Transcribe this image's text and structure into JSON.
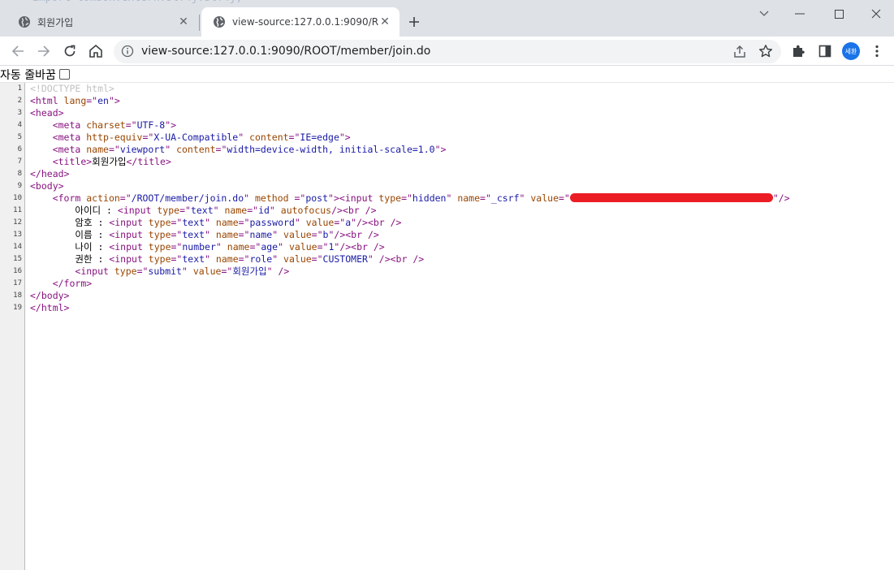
{
  "browser": {
    "tabs": [
      {
        "title": "회원가입",
        "active": false
      },
      {
        "title": "view-source:127.0.0.1:9090/ROOT/member/join.do",
        "active": true
      }
    ],
    "address": "view-source:127.0.0.1:9090/ROOT/member/join.do",
    "profile_initials": "세환",
    "icons": [
      "globe-icon",
      "close-icon",
      "plus-icon",
      "chevron-down-icon",
      "minimize-icon",
      "maximize-icon",
      "window-close-icon",
      "back-icon",
      "forward-icon",
      "reload-icon",
      "home-icon",
      "info-icon",
      "share-icon",
      "star-icon",
      "puzzle-icon",
      "side-panel-icon",
      "kebab-icon"
    ],
    "colors": {
      "tabstrip": "#dee1e6",
      "omnibox": "#f1f3f4",
      "avatar": "#1a73e8",
      "redaction": "#ec1c24"
    }
  },
  "viewsource": {
    "wrap_label": "자동 줄바꿈",
    "wrap_checked": false,
    "lines": [
      {
        "n": "1",
        "tokens": [
          {
            "c": "d",
            "t": "<!DOCTYPE html>"
          }
        ]
      },
      {
        "n": "2",
        "tokens": [
          {
            "c": "t",
            "t": "<html "
          },
          {
            "c": "a",
            "t": "lang"
          },
          {
            "c": "t",
            "t": "=\""
          },
          {
            "c": "v",
            "t": "en"
          },
          {
            "c": "t",
            "t": "\">"
          }
        ]
      },
      {
        "n": "3",
        "tokens": [
          {
            "c": "t",
            "t": "<head>"
          }
        ]
      },
      {
        "n": "4",
        "tokens": [
          {
            "c": "",
            "t": "    "
          },
          {
            "c": "t",
            "t": "<meta "
          },
          {
            "c": "a",
            "t": "charset"
          },
          {
            "c": "t",
            "t": "=\""
          },
          {
            "c": "v",
            "t": "UTF-8"
          },
          {
            "c": "t",
            "t": "\">"
          }
        ]
      },
      {
        "n": "5",
        "tokens": [
          {
            "c": "",
            "t": "    "
          },
          {
            "c": "t",
            "t": "<meta "
          },
          {
            "c": "a",
            "t": "http-equiv"
          },
          {
            "c": "t",
            "t": "=\""
          },
          {
            "c": "v",
            "t": "X-UA-Compatible"
          },
          {
            "c": "t",
            "t": "\" "
          },
          {
            "c": "a",
            "t": "content"
          },
          {
            "c": "t",
            "t": "=\""
          },
          {
            "c": "v",
            "t": "IE=edge"
          },
          {
            "c": "t",
            "t": "\">"
          }
        ]
      },
      {
        "n": "6",
        "tokens": [
          {
            "c": "",
            "t": "    "
          },
          {
            "c": "t",
            "t": "<meta "
          },
          {
            "c": "a",
            "t": "name"
          },
          {
            "c": "t",
            "t": "=\""
          },
          {
            "c": "v",
            "t": "viewport"
          },
          {
            "c": "t",
            "t": "\" "
          },
          {
            "c": "a",
            "t": "content"
          },
          {
            "c": "t",
            "t": "=\""
          },
          {
            "c": "v",
            "t": "width=device-width, initial-scale=1.0"
          },
          {
            "c": "t",
            "t": "\">"
          }
        ]
      },
      {
        "n": "7",
        "tokens": [
          {
            "c": "",
            "t": "    "
          },
          {
            "c": "t",
            "t": "<title>"
          },
          {
            "c": "",
            "t": "회원가입"
          },
          {
            "c": "t",
            "t": "</title>"
          }
        ]
      },
      {
        "n": "8",
        "tokens": [
          {
            "c": "t",
            "t": "</head>"
          }
        ]
      },
      {
        "n": "9",
        "tokens": [
          {
            "c": "t",
            "t": "<body>"
          }
        ]
      },
      {
        "n": "10",
        "tokens": [
          {
            "c": "",
            "t": "    "
          },
          {
            "c": "t",
            "t": "<form "
          },
          {
            "c": "a",
            "t": "action"
          },
          {
            "c": "t",
            "t": "=\""
          },
          {
            "c": "v",
            "t": "/ROOT/member/join.do"
          },
          {
            "c": "t",
            "t": "\" "
          },
          {
            "c": "a",
            "t": "method "
          },
          {
            "c": "t",
            "t": "=\""
          },
          {
            "c": "v",
            "t": "post"
          },
          {
            "c": "t",
            "t": "\">"
          },
          {
            "c": "t",
            "t": "<input "
          },
          {
            "c": "a",
            "t": "type"
          },
          {
            "c": "t",
            "t": "=\""
          },
          {
            "c": "v",
            "t": "hidden"
          },
          {
            "c": "t",
            "t": "\" "
          },
          {
            "c": "a",
            "t": "name"
          },
          {
            "c": "t",
            "t": "=\""
          },
          {
            "c": "v",
            "t": "_csrf"
          },
          {
            "c": "t",
            "t": "\" "
          },
          {
            "c": "a",
            "t": "value"
          },
          {
            "c": "t",
            "t": "=\""
          },
          {
            "c": "redact",
            "t": ""
          },
          {
            "c": "t",
            "t": "\"/>"
          }
        ]
      },
      {
        "n": "11",
        "tokens": [
          {
            "c": "",
            "t": "        아이디 : "
          },
          {
            "c": "t",
            "t": "<input "
          },
          {
            "c": "a",
            "t": "type"
          },
          {
            "c": "t",
            "t": "=\""
          },
          {
            "c": "v",
            "t": "text"
          },
          {
            "c": "t",
            "t": "\" "
          },
          {
            "c": "a",
            "t": "name"
          },
          {
            "c": "t",
            "t": "=\""
          },
          {
            "c": "v",
            "t": "id"
          },
          {
            "c": "t",
            "t": "\" "
          },
          {
            "c": "a",
            "t": "autofocus"
          },
          {
            "c": "t",
            "t": "/>"
          },
          {
            "c": "t",
            "t": "<br />"
          }
        ]
      },
      {
        "n": "12",
        "tokens": [
          {
            "c": "",
            "t": "        암호 : "
          },
          {
            "c": "t",
            "t": "<input "
          },
          {
            "c": "a",
            "t": "type"
          },
          {
            "c": "t",
            "t": "=\""
          },
          {
            "c": "v",
            "t": "text"
          },
          {
            "c": "t",
            "t": "\" "
          },
          {
            "c": "a",
            "t": "name"
          },
          {
            "c": "t",
            "t": "=\""
          },
          {
            "c": "v",
            "t": "password"
          },
          {
            "c": "t",
            "t": "\" "
          },
          {
            "c": "a",
            "t": "value"
          },
          {
            "c": "t",
            "t": "=\""
          },
          {
            "c": "v",
            "t": "a"
          },
          {
            "c": "t",
            "t": "\"/>"
          },
          {
            "c": "t",
            "t": "<br />"
          }
        ]
      },
      {
        "n": "13",
        "tokens": [
          {
            "c": "",
            "t": "        이름 : "
          },
          {
            "c": "t",
            "t": "<input "
          },
          {
            "c": "a",
            "t": "type"
          },
          {
            "c": "t",
            "t": "=\""
          },
          {
            "c": "v",
            "t": "text"
          },
          {
            "c": "t",
            "t": "\" "
          },
          {
            "c": "a",
            "t": "name"
          },
          {
            "c": "t",
            "t": "=\""
          },
          {
            "c": "v",
            "t": "name"
          },
          {
            "c": "t",
            "t": "\" "
          },
          {
            "c": "a",
            "t": "value"
          },
          {
            "c": "t",
            "t": "=\""
          },
          {
            "c": "v",
            "t": "b"
          },
          {
            "c": "t",
            "t": "\"/>"
          },
          {
            "c": "t",
            "t": "<br />"
          }
        ]
      },
      {
        "n": "14",
        "tokens": [
          {
            "c": "",
            "t": "        나이 : "
          },
          {
            "c": "t",
            "t": "<input "
          },
          {
            "c": "a",
            "t": "type"
          },
          {
            "c": "t",
            "t": "=\""
          },
          {
            "c": "v",
            "t": "number"
          },
          {
            "c": "t",
            "t": "\" "
          },
          {
            "c": "a",
            "t": "name"
          },
          {
            "c": "t",
            "t": "=\""
          },
          {
            "c": "v",
            "t": "age"
          },
          {
            "c": "t",
            "t": "\" "
          },
          {
            "c": "a",
            "t": "value"
          },
          {
            "c": "t",
            "t": "=\""
          },
          {
            "c": "v",
            "t": "1"
          },
          {
            "c": "t",
            "t": "\"/>"
          },
          {
            "c": "t",
            "t": "<br />"
          }
        ]
      },
      {
        "n": "15",
        "tokens": [
          {
            "c": "",
            "t": "        권한 : "
          },
          {
            "c": "t",
            "t": "<input "
          },
          {
            "c": "a",
            "t": "type"
          },
          {
            "c": "t",
            "t": "=\""
          },
          {
            "c": "v",
            "t": "text"
          },
          {
            "c": "t",
            "t": "\" "
          },
          {
            "c": "a",
            "t": "name"
          },
          {
            "c": "t",
            "t": "=\""
          },
          {
            "c": "v",
            "t": "role"
          },
          {
            "c": "t",
            "t": "\" "
          },
          {
            "c": "a",
            "t": "value"
          },
          {
            "c": "t",
            "t": "=\""
          },
          {
            "c": "v",
            "t": "CUSTOMER"
          },
          {
            "c": "t",
            "t": "\" />"
          },
          {
            "c": "t",
            "t": "<br />"
          }
        ]
      },
      {
        "n": "16",
        "tokens": [
          {
            "c": "",
            "t": "        "
          },
          {
            "c": "t",
            "t": "<input "
          },
          {
            "c": "a",
            "t": "type"
          },
          {
            "c": "t",
            "t": "=\""
          },
          {
            "c": "v",
            "t": "submit"
          },
          {
            "c": "t",
            "t": "\" "
          },
          {
            "c": "a",
            "t": "value"
          },
          {
            "c": "t",
            "t": "=\""
          },
          {
            "c": "v",
            "t": "회원가입"
          },
          {
            "c": "t",
            "t": "\" />"
          }
        ]
      },
      {
        "n": "17",
        "tokens": [
          {
            "c": "",
            "t": "    "
          },
          {
            "c": "t",
            "t": "</form>"
          }
        ]
      },
      {
        "n": "18",
        "tokens": [
          {
            "c": "t",
            "t": "</body>"
          }
        ]
      },
      {
        "n": "19",
        "tokens": [
          {
            "c": "t",
            "t": "</html>"
          }
        ]
      }
    ]
  }
}
